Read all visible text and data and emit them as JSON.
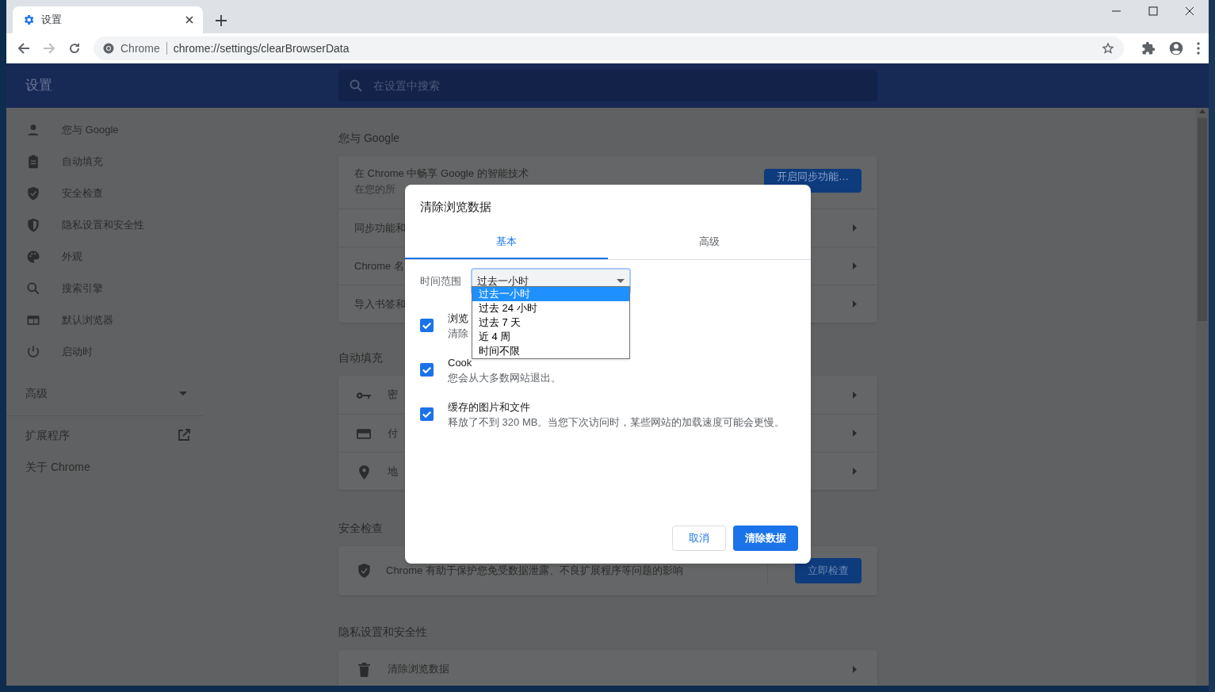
{
  "browser": {
    "tab": {
      "title": "设置"
    },
    "address": {
      "site": "Chrome",
      "url": "chrome://settings/clearBrowserData"
    }
  },
  "header": {
    "title": "设置",
    "search_placeholder": "在设置中搜索"
  },
  "sidebar": {
    "items": [
      {
        "label": "您与 Google"
      },
      {
        "label": "自动填充"
      },
      {
        "label": "安全检查"
      },
      {
        "label": "隐私设置和安全性"
      },
      {
        "label": "外观"
      },
      {
        "label": "搜索引擎"
      },
      {
        "label": "默认浏览器"
      },
      {
        "label": "启动时"
      }
    ],
    "advanced": {
      "label": "高级",
      "expanded": false
    },
    "extensions": "扩展程序",
    "about": "关于 Chrome"
  },
  "sections": [
    {
      "title": "您与 Google",
      "rows": [
        {
          "kind": "promo",
          "title": "在 Chrome 中畅享 Google 的智能技术",
          "subtitle": "在您的所",
          "button": "开启同步功能…"
        },
        {
          "kind": "link",
          "title": "同步功能和"
        },
        {
          "kind": "link",
          "title": "Chrome 名"
        },
        {
          "kind": "link",
          "title": "导入书签和"
        }
      ]
    },
    {
      "title": "自动填充",
      "rows": [
        {
          "kind": "icon-link",
          "title": "密"
        },
        {
          "kind": "icon-link",
          "title": "付"
        },
        {
          "kind": "icon-link",
          "title": "地"
        }
      ]
    },
    {
      "title": "安全检查",
      "rows": [
        {
          "kind": "action",
          "title": "Chrome 有助于保护您免受数据泄露、不良扩展程序等问题的影响",
          "button": "立即检查"
        }
      ]
    },
    {
      "title": "隐私设置和安全性",
      "rows": [
        {
          "kind": "icon-link",
          "title": "清除浏览数据"
        }
      ]
    }
  ],
  "dialog": {
    "title": "清除浏览数据",
    "tabs": [
      {
        "label": "基本",
        "selected": true
      },
      {
        "label": "高级",
        "selected": false
      }
    ],
    "time_range": {
      "label": "时间范围",
      "value": "过去一小时",
      "expanded": true,
      "options": [
        {
          "label": "过去一小时",
          "selected": true
        },
        {
          "label": "过去 24 小时",
          "selected": false
        },
        {
          "label": "过去 7 天",
          "selected": false
        },
        {
          "label": "近 4 周",
          "selected": false
        },
        {
          "label": "时间不限",
          "selected": false
        }
      ]
    },
    "options": [
      {
        "title": "浏览",
        "subtitle": "清除",
        "checked": true
      },
      {
        "title": "Cook",
        "subtitle": "您会从大多数网站退出。",
        "checked": true
      },
      {
        "title": "缓存的图片和文件",
        "subtitle": "释放了不到 320 MB。当您下次访问时，某些网站的加载速度可能会更慢。",
        "checked": true
      }
    ],
    "buttons": [
      {
        "label": "取消",
        "kind": "secondary"
      },
      {
        "label": "清除数据",
        "kind": "primary"
      }
    ]
  }
}
